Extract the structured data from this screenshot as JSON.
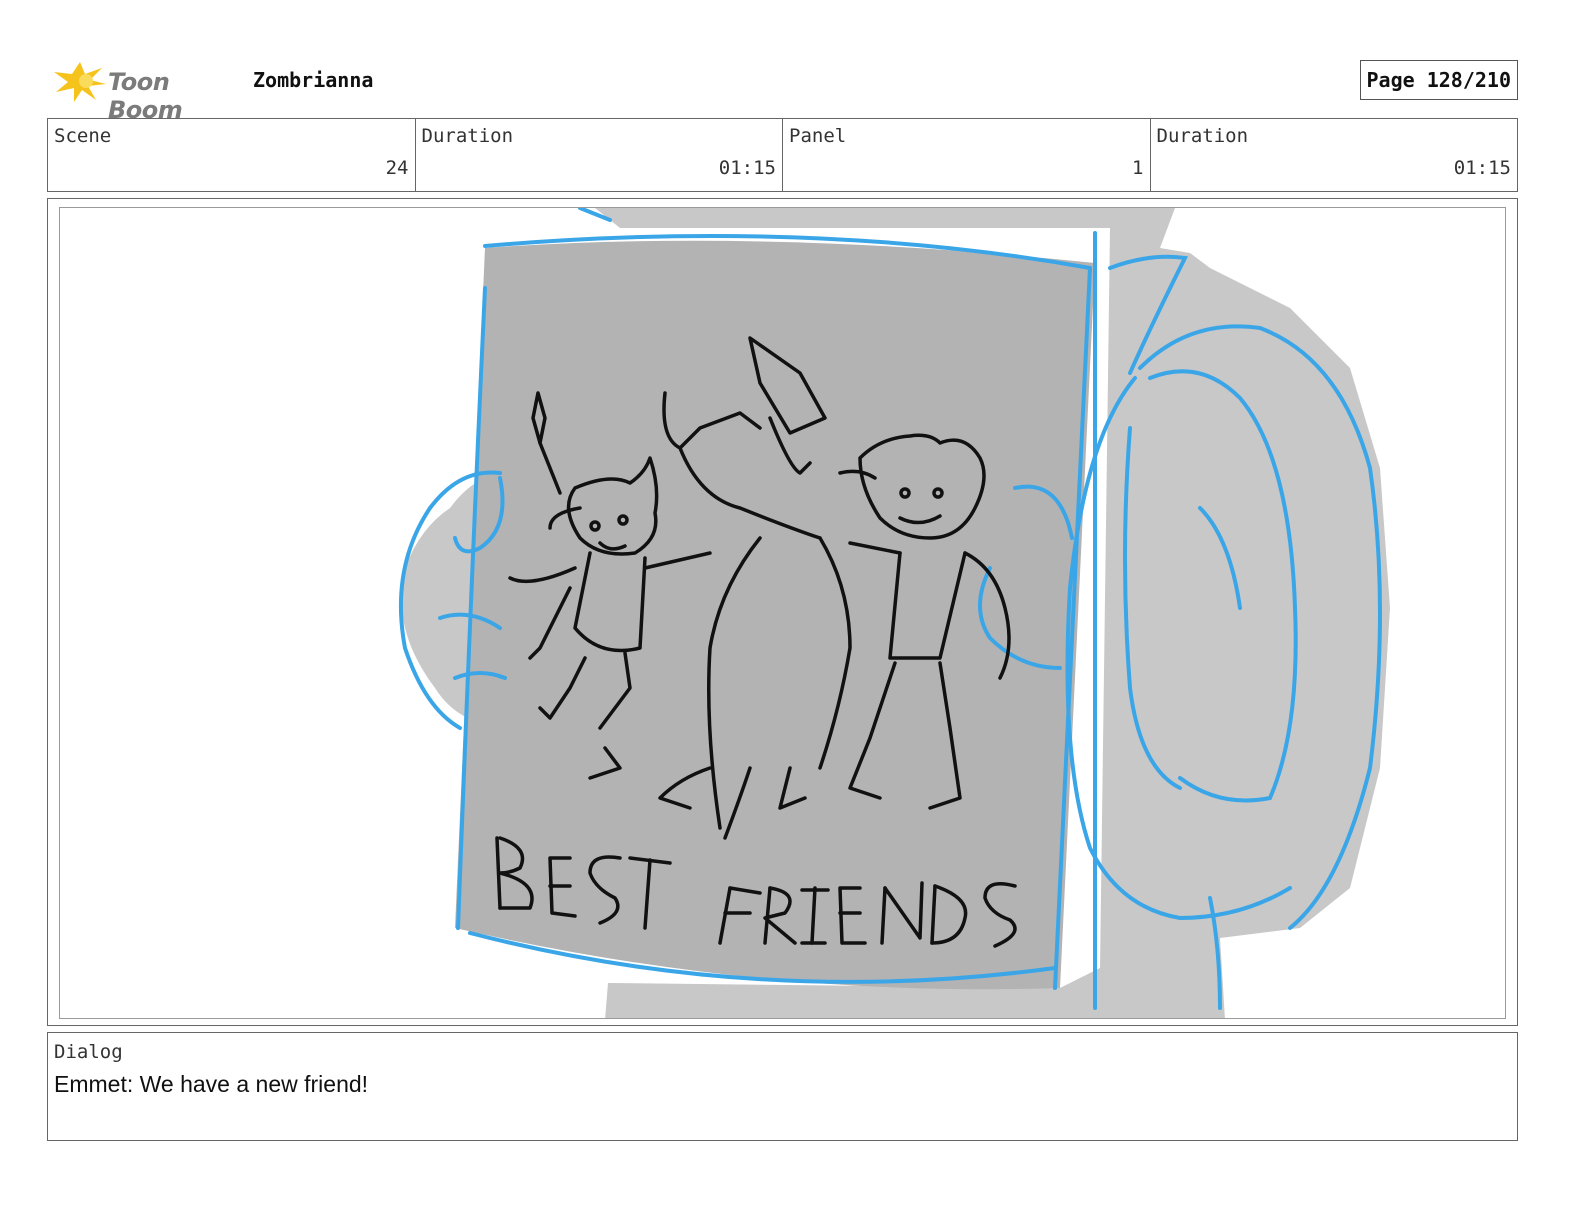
{
  "header": {
    "logo_text": "Toon Boom",
    "project_title": "Zombrianna",
    "page_label": "Page 128/210"
  },
  "info": [
    {
      "label": "Scene",
      "value": "24"
    },
    {
      "label": "Duration",
      "value": "01:15"
    },
    {
      "label": "Panel",
      "value": "1"
    },
    {
      "label": "Duration",
      "value": "01:15"
    }
  ],
  "panel": {
    "sketch_text": "BEST FRIENDS",
    "colors": {
      "blue_line": "#3aa6e8",
      "light_gray": "#c8c8c8",
      "mid_gray": "#b3b3b3",
      "ink": "#111111"
    }
  },
  "dialog": {
    "label": "Dialog",
    "text": "Emmet: We have a new friend!"
  }
}
